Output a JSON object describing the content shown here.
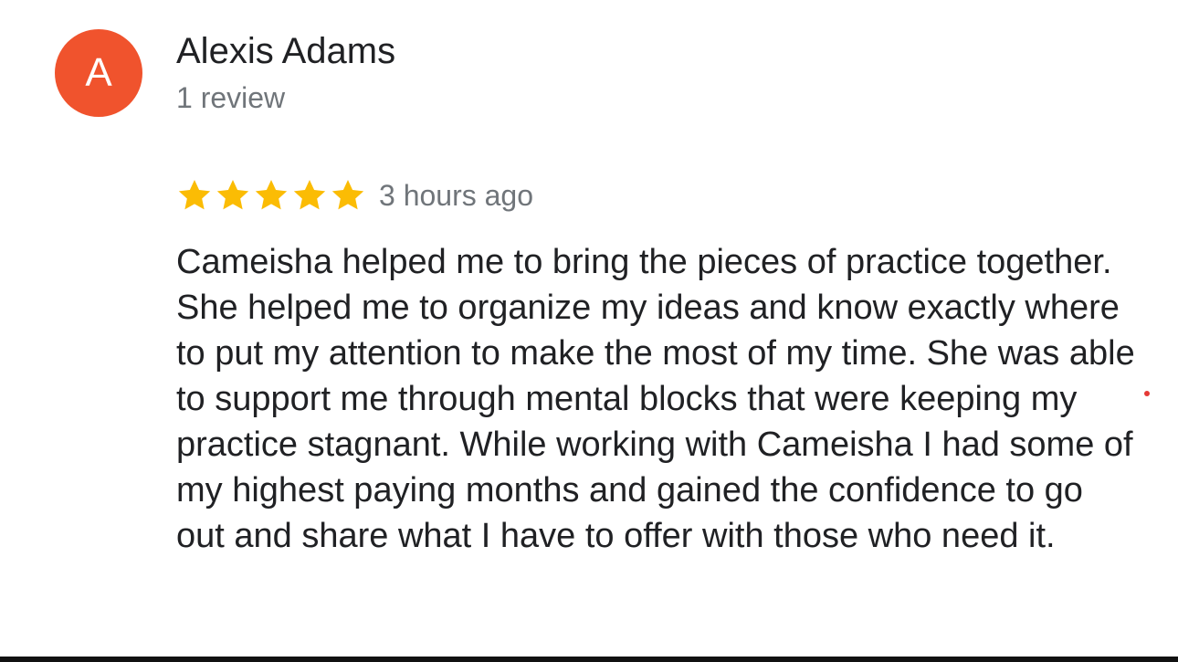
{
  "reviewer": {
    "avatar_letter": "A",
    "avatar_color": "#f0532d",
    "name": "Alexis Adams",
    "review_count": "1 review"
  },
  "review": {
    "rating": 5,
    "max_rating": 5,
    "star_color": "#fbbc04",
    "star_icon": "star-icon",
    "timestamp": "3 hours ago",
    "text": "Cameisha helped me to bring the pieces of practice together. She helped me to organize my ideas and know exactly where to put my attention to make the most of my time. She was able to support me through mental blocks that were keeping my practice stagnant. While working with Cameisha I had some of my highest paying months and gained the confidence to go out and share what I have to offer with those who need it."
  },
  "colors": {
    "name_text": "#202124",
    "secondary_text": "#70757a",
    "indicator_dot": "#e53935"
  }
}
